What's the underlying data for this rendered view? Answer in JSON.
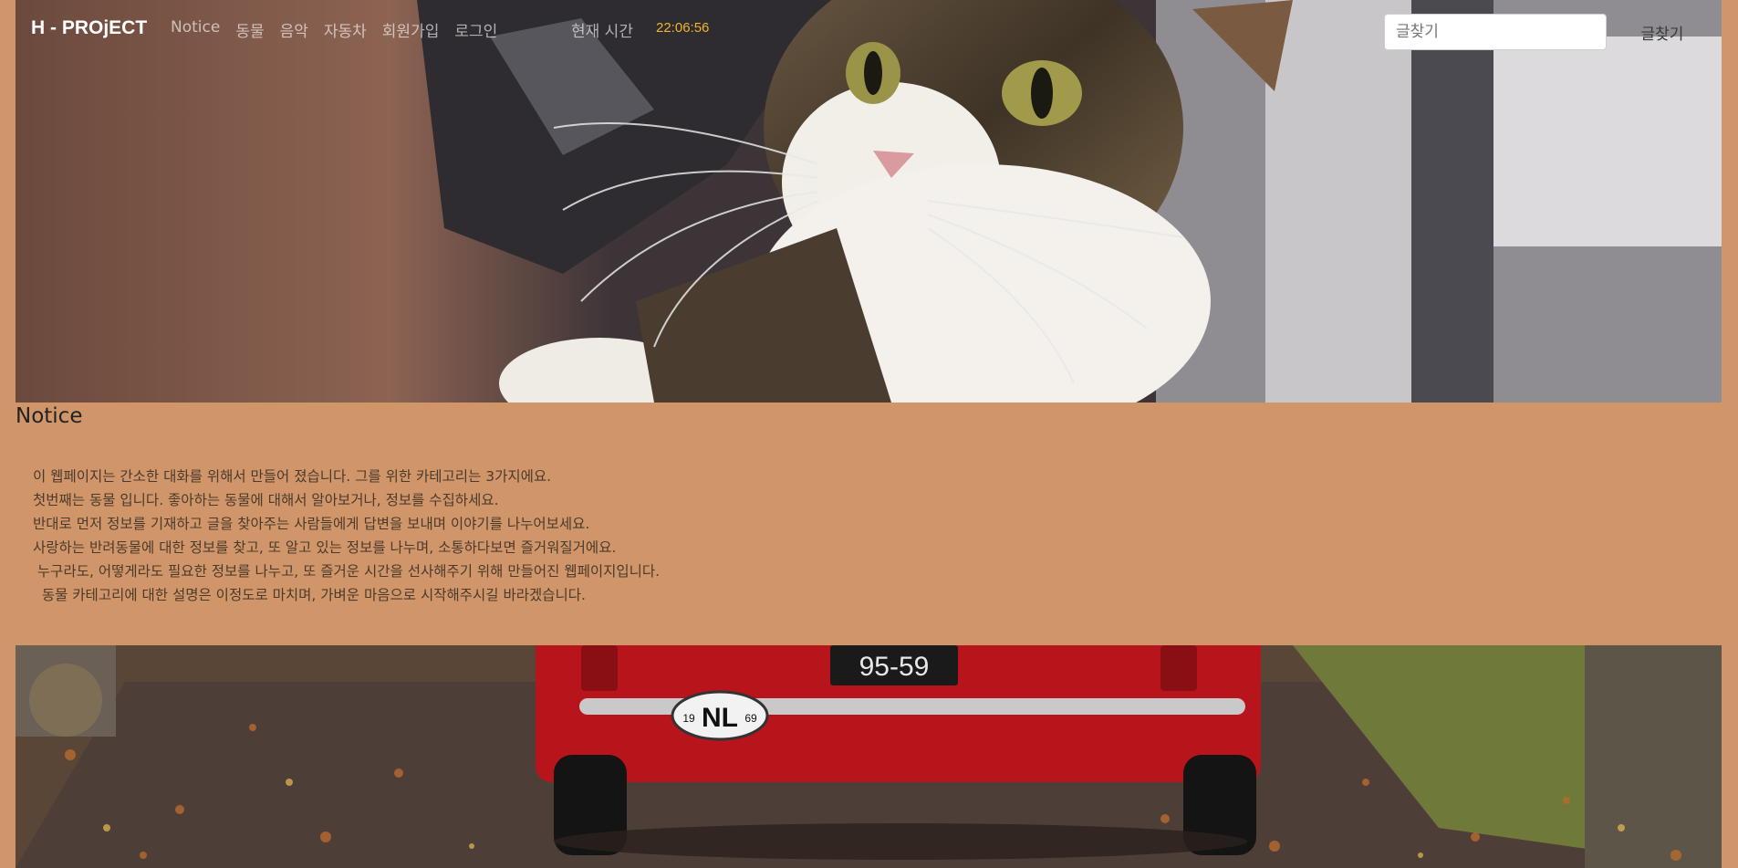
{
  "brand": "H - PROjECT",
  "nav": {
    "items": [
      {
        "label": "Notice"
      },
      {
        "label": "동물"
      },
      {
        "label": "음악"
      },
      {
        "label": "자동차"
      },
      {
        "label": "회원가입"
      },
      {
        "label": "로그인"
      }
    ],
    "clock_label": "현재 시간",
    "clock_value": "22:06:56"
  },
  "search": {
    "placeholder": "글찾기",
    "value": "",
    "button_label": "글찾기"
  },
  "notice": {
    "title": "Notice",
    "lines": [
      "이 웹페이지는 간소한 대화를 위해서 만들어 졌습니다. 그를 위한 카테고리는 3가지에요.",
      "첫번째는 동물 입니다. 좋아하는 동물에 대해서 알아보거나, 정보를 수집하세요.",
      "반대로 먼저 정보를 기재하고 글을 찾아주는 사람들에게 답변을 보내며 이야기를 나누어보세요.",
      "사랑하는 반려동물에 대한 정보를 찾고, 또 알고 있는 정보를 나누며, 소통하다보면 즐거워질거에요.",
      " 누구라도, 어떻게라도 필요한 정보를 나누고, 또 즐거운 시간을 선사해주기 위해 만들어진 웹페이지입니다.",
      "  동물 카테고리에 대한 설명은 이정도로 마치며, 가벼운 마음으로 시작해주시길 바라겠습니다."
    ]
  },
  "images": {
    "hero": "cat-photo",
    "bottom": "red-car-photo",
    "plate_number": "95-59",
    "country_badge": "NL",
    "badge_left": "19",
    "badge_right": "69"
  },
  "colors": {
    "page_bg": "#d0966a",
    "clock": "#f0b428",
    "nav_text": "#ffffff"
  }
}
